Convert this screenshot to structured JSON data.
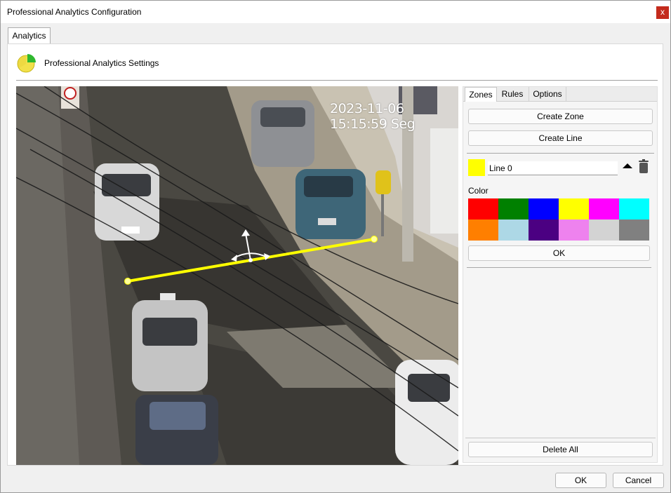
{
  "window": {
    "title": "Professional Analytics Configuration",
    "close_label": "x"
  },
  "tabs": {
    "analytics": "Analytics"
  },
  "header": {
    "title": "Professional Analytics Settings"
  },
  "video": {
    "timestamp": "2023-11-06 15:15:59 Seg"
  },
  "side_panel": {
    "tabs": [
      "Zones",
      "Rules",
      "Options"
    ],
    "active_tab": "Zones",
    "create_zone": "Create Zone",
    "create_line": "Create Line",
    "line_item": {
      "name": "Line 0",
      "color": "#ffff00"
    },
    "color_label": "Color",
    "palette": [
      "#ff0000",
      "#008000",
      "#0000ff",
      "#ffff00",
      "#ff00ff",
      "#00ffff",
      "#ff7f00",
      "#add8e6",
      "#4b0082",
      "#ee82ee",
      "#d3d3d3",
      "#808080"
    ],
    "ok": "OK",
    "delete_all": "Delete All"
  },
  "footer": {
    "ok": "OK",
    "cancel": "Cancel"
  }
}
